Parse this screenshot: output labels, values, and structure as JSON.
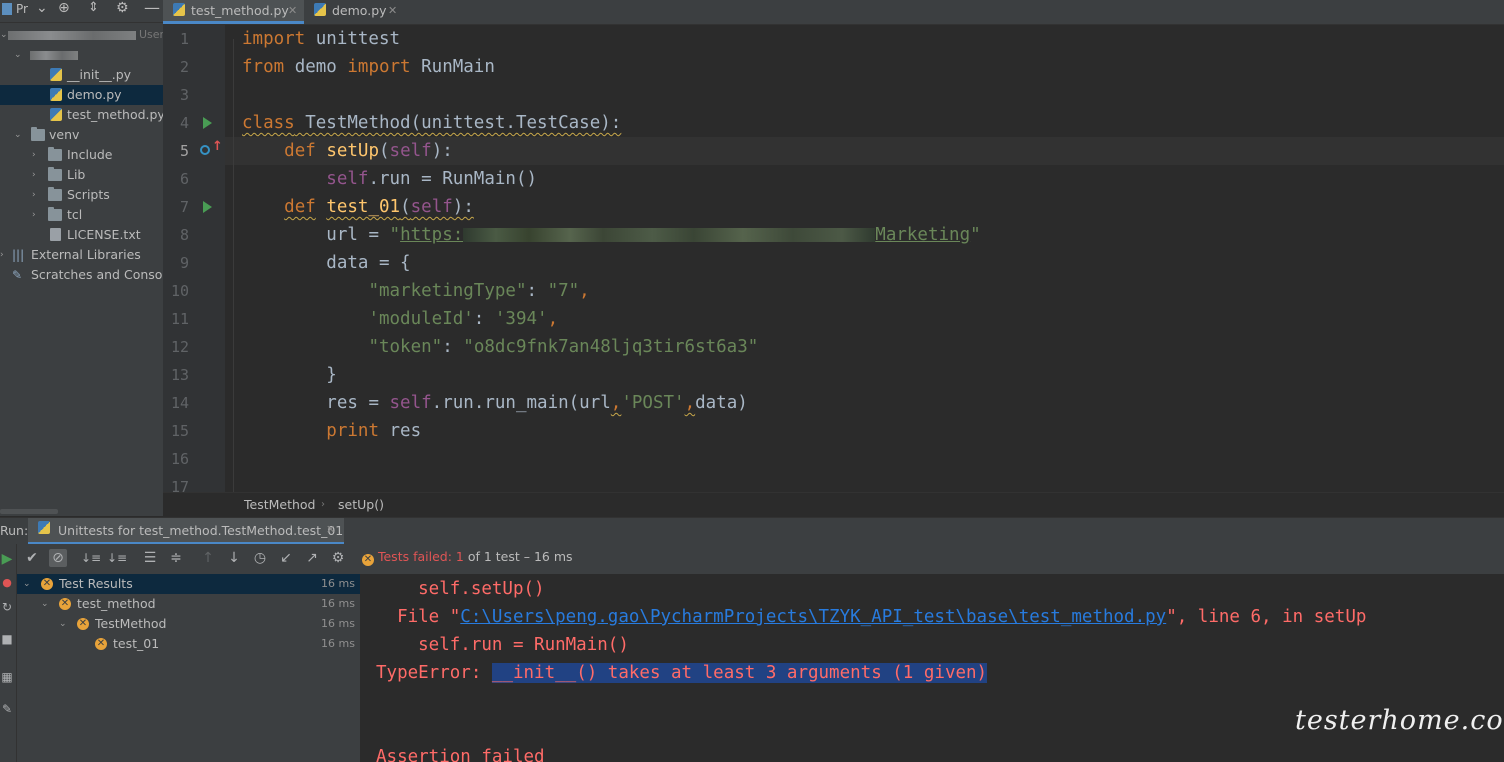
{
  "project": {
    "toolbar_label": "Pr",
    "header_user": "User",
    "tree": [
      {
        "label": "",
        "type": "blurred"
      },
      {
        "label": "__init__.py",
        "type": "py"
      },
      {
        "label": "demo.py",
        "type": "py",
        "selected": true
      },
      {
        "label": "test_method.py",
        "type": "py"
      },
      {
        "label": "venv",
        "type": "folder"
      },
      {
        "label": "Include",
        "type": "folder"
      },
      {
        "label": "Lib",
        "type": "folder"
      },
      {
        "label": "Scripts",
        "type": "folder"
      },
      {
        "label": "tcl",
        "type": "folder"
      },
      {
        "label": "LICENSE.txt",
        "type": "txt"
      },
      {
        "label": "External Libraries",
        "type": "lib"
      },
      {
        "label": "Scratches and Consoles",
        "type": "scratch"
      }
    ]
  },
  "tabs": [
    {
      "label": "test_method.py",
      "active": true
    },
    {
      "label": "demo.py",
      "active": false
    }
  ],
  "editor": {
    "line_numbers": [
      "1",
      "2",
      "3",
      "4",
      "5",
      "6",
      "7",
      "8",
      "9",
      "10",
      "11",
      "12",
      "13",
      "14",
      "15",
      "16",
      "17"
    ],
    "current_line": "5",
    "code": {
      "l1_kw": "import",
      "l1_rest": " unittest",
      "l2_kw1": "from",
      "l2_mod": " demo ",
      "l2_kw2": "import",
      "l2_rest": " RunMain",
      "l4_kw": "class",
      "l4_name": " TestMethod(unittest.TestCase):",
      "l5_kw": "def",
      "l5_fn": "setUp",
      "l5_p1": "(",
      "l5_self": "self",
      "l5_p2": "):",
      "l6_self": "self",
      "l6_rest": ".run = RunMain()",
      "l7_kw": "def",
      "l7_fn": "test_01",
      "l7_p1": "(",
      "l7_self": "self",
      "l7_p2": "):",
      "l8_a": "url = ",
      "l8_q1": "\"",
      "l8_url1": "https:",
      "l8_url2": "Marketing",
      "l8_q2": "\"",
      "l9": "data = {",
      "l10_k": "\"marketingType\"",
      "l10_c": ": ",
      "l10_v": "\"7\"",
      "l10_e": ",",
      "l11_k": "'moduleId'",
      "l11_c": ": ",
      "l11_v": "'394'",
      "l11_e": ",",
      "l12_k": "\"token\"",
      "l12_c": ": ",
      "l12_v": "\"o8dc9fnk7an48ljq3tir6st6a3\"",
      "l13": "}",
      "l14_a": "res = ",
      "l14_self": "self",
      "l14_b": ".run.run_main(url",
      "l14_c1": ",",
      "l14_s": "'POST'",
      "l14_c2": ",",
      "l14_d": "data)",
      "l15_kw": "print",
      "l15_rest": " res"
    }
  },
  "breadcrumb": {
    "class_name": "TestMethod",
    "method_name": "setUp()"
  },
  "run": {
    "label": "Run:",
    "tab_label": "Unittests for test_method.TestMethod.test_01",
    "status_failed": "Tests failed: ",
    "status_count": "1",
    "status_rest": " of 1 test – 16 ms",
    "results": [
      {
        "label": "Test Results",
        "ms": "16 ms",
        "level": 0,
        "selected": true
      },
      {
        "label": "test_method",
        "ms": "16 ms",
        "level": 1
      },
      {
        "label": "TestMethod",
        "ms": "16 ms",
        "level": 2
      },
      {
        "label": "test_01",
        "ms": "16 ms",
        "level": 3
      }
    ],
    "console": {
      "c1": "    self.setUp()",
      "c2_a": "  File \"",
      "c2_link": "C:\\Users\\peng.gao\\PycharmProjects\\TZYK_API_test\\base\\test_method.py",
      "c2_b": "\", line 6, in setUp",
      "c3": "    self.run = RunMain()",
      "c4_a": "TypeError: ",
      "c4_hl": "__init__() takes at least 3 arguments (1 given)",
      "c5": "Assertion failed"
    }
  },
  "watermark": "testerhome.com",
  "colors": {
    "keyword": "#cc7832",
    "function": "#ffc66d",
    "self": "#94558d",
    "string": "#6a8759",
    "error": "#ff6b68",
    "link": "#287bde",
    "accent": "#4a88c7"
  }
}
